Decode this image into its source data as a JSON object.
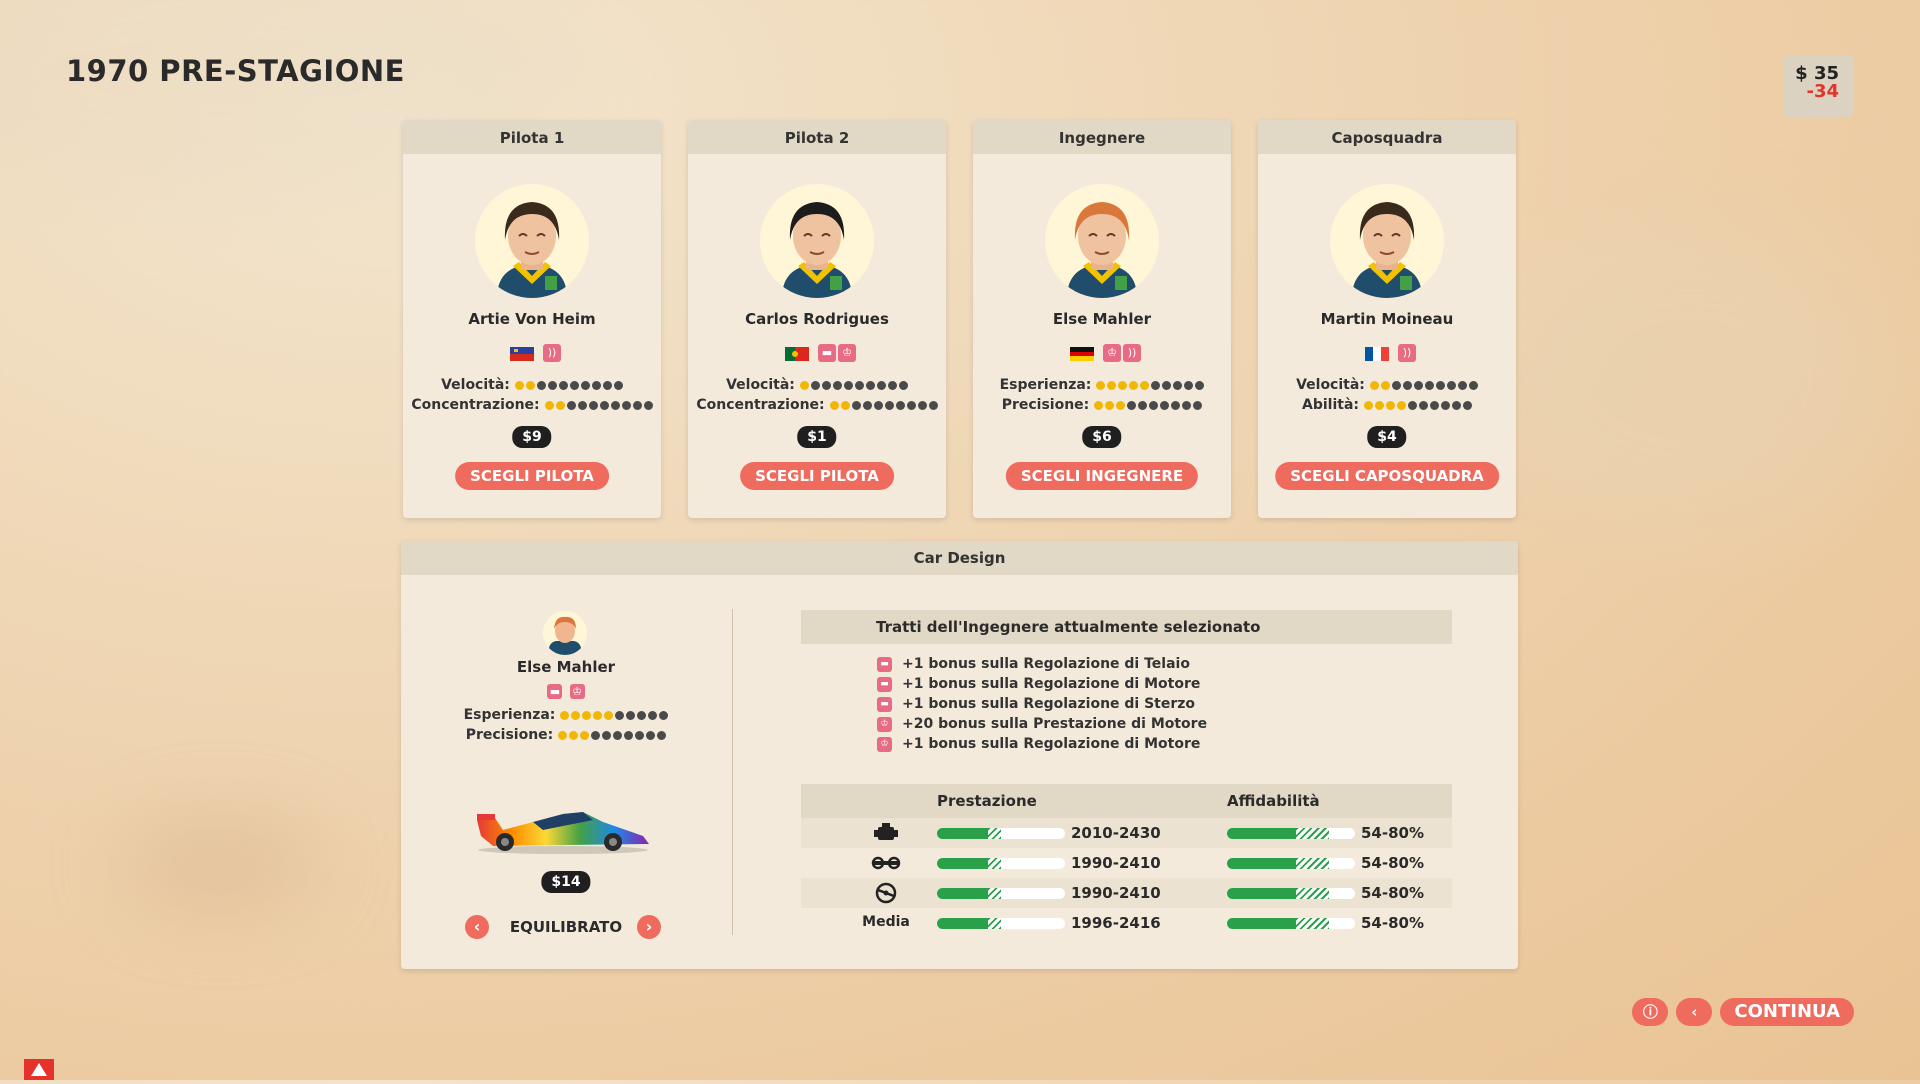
{
  "page_title": "1970 PRE-STAGIONE",
  "money": {
    "cash": "$ 35",
    "delta": "-34"
  },
  "cards": [
    {
      "role": "Pilota 1",
      "name": "Artie Von Heim",
      "flag": "flag-liechtenstein",
      "traits": [
        "trait-icon"
      ],
      "stats": [
        {
          "label": "Velocità:",
          "value": 2
        },
        {
          "label": "Concentrazione:",
          "value": 2
        }
      ],
      "price": "$9",
      "button": "SCEGLI PILOTA",
      "hair": "#3a2a1c"
    },
    {
      "role": "Pilota 2",
      "name": "Carlos Rodrigues",
      "flag": "flag-portugal",
      "traits": [
        "trait-icon",
        "trait-icon"
      ],
      "stats": [
        {
          "label": "Velocità:",
          "value": 1
        },
        {
          "label": "Concentrazione:",
          "value": 2
        }
      ],
      "price": "$1",
      "button": "SCEGLI PILOTA",
      "hair": "#1c1c1c"
    },
    {
      "role": "Ingegnere",
      "name": "Else Mahler",
      "flag": "flag-germany",
      "traits": [
        "trait-icon",
        "trait-icon"
      ],
      "stats": [
        {
          "label": "Esperienza:",
          "value": 5
        },
        {
          "label": "Precisione:",
          "value": 3
        }
      ],
      "price": "$6",
      "button": "SCEGLI INGEGNERE",
      "hair": "#d9783a"
    },
    {
      "role": "Caposquadra",
      "name": "Martin Moineau",
      "flag": "flag-france",
      "traits": [
        "trait-icon"
      ],
      "stats": [
        {
          "label": "Velocità:",
          "value": 2
        },
        {
          "label": "Abilità:",
          "value": 4
        }
      ],
      "price": "$4",
      "button": "SCEGLI CAPOSQUADRA",
      "hair": "#3a2a1c"
    }
  ],
  "car_design": {
    "title": "Car Design",
    "engineer": {
      "name": "Else Mahler",
      "stats": [
        {
          "label": "Esperienza:",
          "value": 5
        },
        {
          "label": "Precisione:",
          "value": 3
        }
      ]
    },
    "price": "$14",
    "mode": "EQUILIBRATO",
    "traits_title": "Tratti dell'Ingegnere attualmente selezionato",
    "traits": [
      "+1 bonus sulla Regolazione di Telaio",
      "+1 bonus sulla Regolazione di Motore",
      "+1 bonus sulla Regolazione di Sterzo",
      "+20 bonus sulla Prestazione di Motore",
      "+1 bonus sulla Regolazione di Motore"
    ],
    "perf_header": {
      "performance": "Prestazione",
      "reliability": "Affidabilità"
    },
    "rows": [
      {
        "icon": "engine-icon",
        "label": "",
        "perf": "2010-2430",
        "rel": "54-80%",
        "perf_fill": 0.4,
        "perf_hatch": 0.1,
        "rel_fill": 0.54,
        "rel_hatch": 0.26
      },
      {
        "icon": "chassis-icon",
        "label": "",
        "perf": "1990-2410",
        "rel": "54-80%",
        "perf_fill": 0.4,
        "perf_hatch": 0.1,
        "rel_fill": 0.54,
        "rel_hatch": 0.26
      },
      {
        "icon": "steering-icon",
        "label": "",
        "perf": "1990-2410",
        "rel": "54-80%",
        "perf_fill": 0.4,
        "perf_hatch": 0.1,
        "rel_fill": 0.54,
        "rel_hatch": 0.26
      },
      {
        "icon": "",
        "label": "Media",
        "perf": "1996-2416",
        "rel": "54-80%",
        "perf_fill": 0.4,
        "perf_hatch": 0.1,
        "rel_fill": 0.54,
        "rel_hatch": 0.26
      }
    ]
  },
  "buttons": {
    "continue": "CONTINUA",
    "info": "ⓘ",
    "back": "‹"
  },
  "colors": {
    "accent": "#ee6b5e",
    "bar_green": "#2aa04a",
    "dot_on": "#f2b705",
    "dot_off": "#4a4a4a"
  }
}
